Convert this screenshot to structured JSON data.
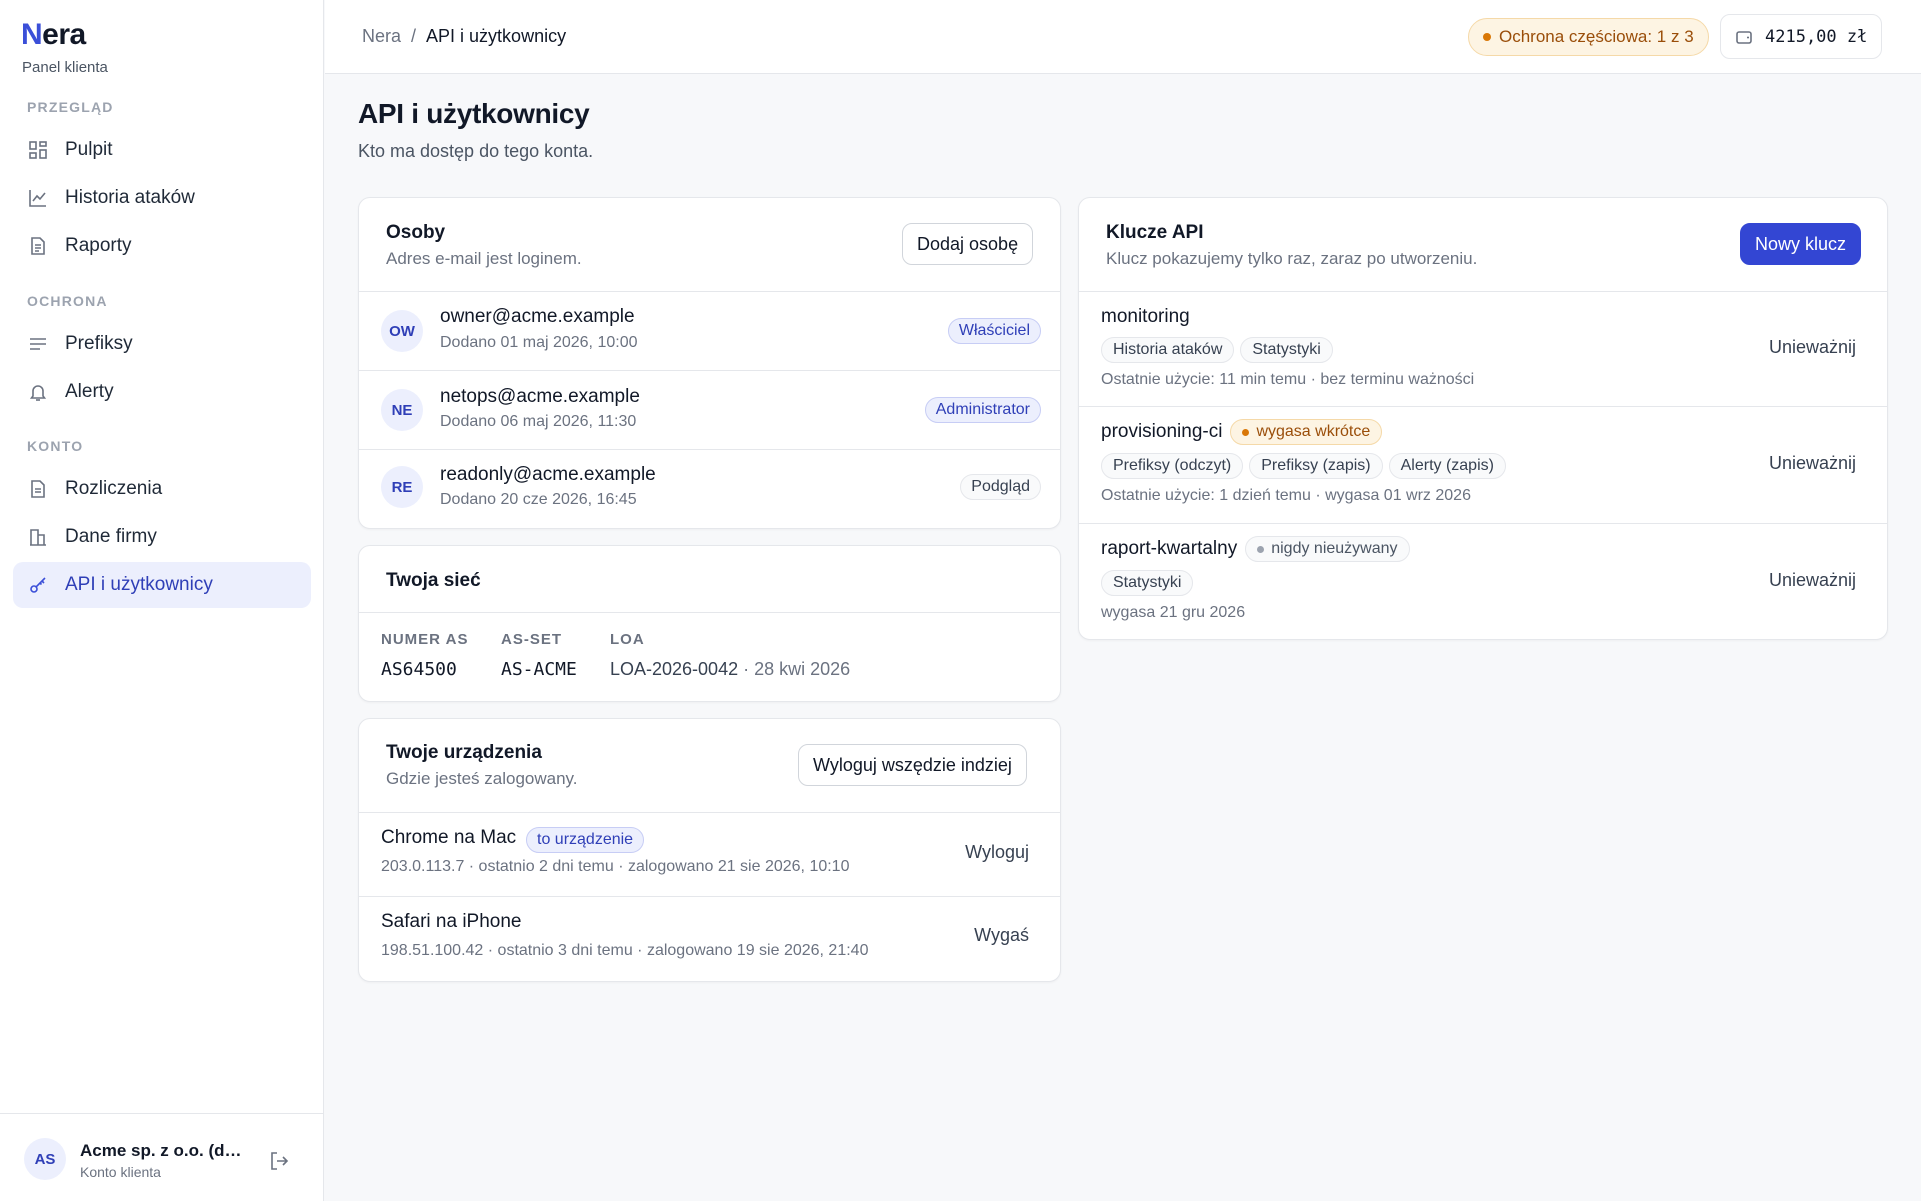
{
  "sidebar": {
    "logo_initial": "N",
    "logo_rest": "era",
    "subtitle": "Panel klienta",
    "sections": {
      "overview": "PRZEGLĄD",
      "protection": "OCHRONA",
      "account": "KONTO"
    },
    "items": {
      "dashboard": "Pulpit",
      "attack_history": "Historia ataków",
      "reports": "Raporty",
      "prefixes": "Prefiksy",
      "alerts": "Alerty",
      "billing": "Rozliczenia",
      "company": "Dane firmy",
      "api_users": "API i użytkownicy"
    },
    "footer": {
      "initials": "AS",
      "name": "Acme sp. z o.o. (demo)",
      "role": "Konto klienta"
    }
  },
  "topbar": {
    "breadcrumb_root": "Nera",
    "breadcrumb_sep": "/",
    "breadcrumb_current": "API i użytkownicy",
    "protection_badge": "Ochrona częściowa: 1 z 3",
    "balance": "4215,00 zł"
  },
  "page": {
    "title": "API i użytkownicy",
    "subtitle": "Kto ma dostęp do tego konta."
  },
  "people": {
    "title": "Osoby",
    "subtitle": "Adres e-mail jest loginem.",
    "add_button": "Dodaj osobę",
    "rows": [
      {
        "initials": "OW",
        "email": "owner@acme.example",
        "added": "Dodano 01 maj 2026, 10:00",
        "role": "Właściciel"
      },
      {
        "initials": "NE",
        "email": "netops@acme.example",
        "added": "Dodano 06 maj 2026, 11:30",
        "role": "Administrator"
      },
      {
        "initials": "RE",
        "email": "readonly@acme.example",
        "added": "Dodano 20 cze 2026, 16:45",
        "role": "Podgląd"
      }
    ]
  },
  "network": {
    "title": "Twoja sieć",
    "as_label": "NUMER AS",
    "as_value": "AS64500",
    "asset_label": "AS-SET",
    "asset_value": "AS-ACME",
    "loa_label": "LOA",
    "loa_value": "LOA-2026-0042",
    "loa_date": "· 28 kwi 2026"
  },
  "devices": {
    "title": "Twoje urządzenia",
    "subtitle": "Gdzie jesteś zalogowany.",
    "logout_all_button": "Wyloguj wszędzie indziej",
    "rows": [
      {
        "name": "Chrome na Mac",
        "badge": "to urządzenie",
        "details": "203.0.113.7 · ostatnio 2 dni temu · zalogowano 21 sie 2026, 10:10",
        "action": "Wyloguj"
      },
      {
        "name": "Safari na iPhone",
        "details": "198.51.100.42 · ostatnio 3 dni temu · zalogowano 19 sie 2026, 21:40",
        "action": "Wygaś"
      }
    ]
  },
  "api_keys": {
    "title": "Klucze API",
    "subtitle": "Klucz pokazujemy tylko raz, zaraz po utworzeniu.",
    "new_button": "Nowy klucz",
    "revoke_label": "Unieważnij",
    "keys": [
      {
        "name": "monitoring",
        "scopes": [
          "Historia ataków",
          "Statystyki"
        ],
        "meta": "Ostatnie użycie: 11 min temu · bez terminu ważności"
      },
      {
        "name": "provisioning-ci",
        "status": "wygasa wkrótce",
        "scopes": [
          "Prefiksy (odczyt)",
          "Prefiksy (zapis)",
          "Alerty (zapis)"
        ],
        "meta": "Ostatnie użycie: 1 dzień temu · wygasa 01 wrz 2026"
      },
      {
        "name": "raport-kwartalny",
        "status": "nigdy nieużywany",
        "scopes": [
          "Statystyki"
        ],
        "meta": "wygasa 21 gru 2026"
      }
    ]
  },
  "colors": {
    "accent": "#3346d3",
    "warning": "#d97706"
  }
}
